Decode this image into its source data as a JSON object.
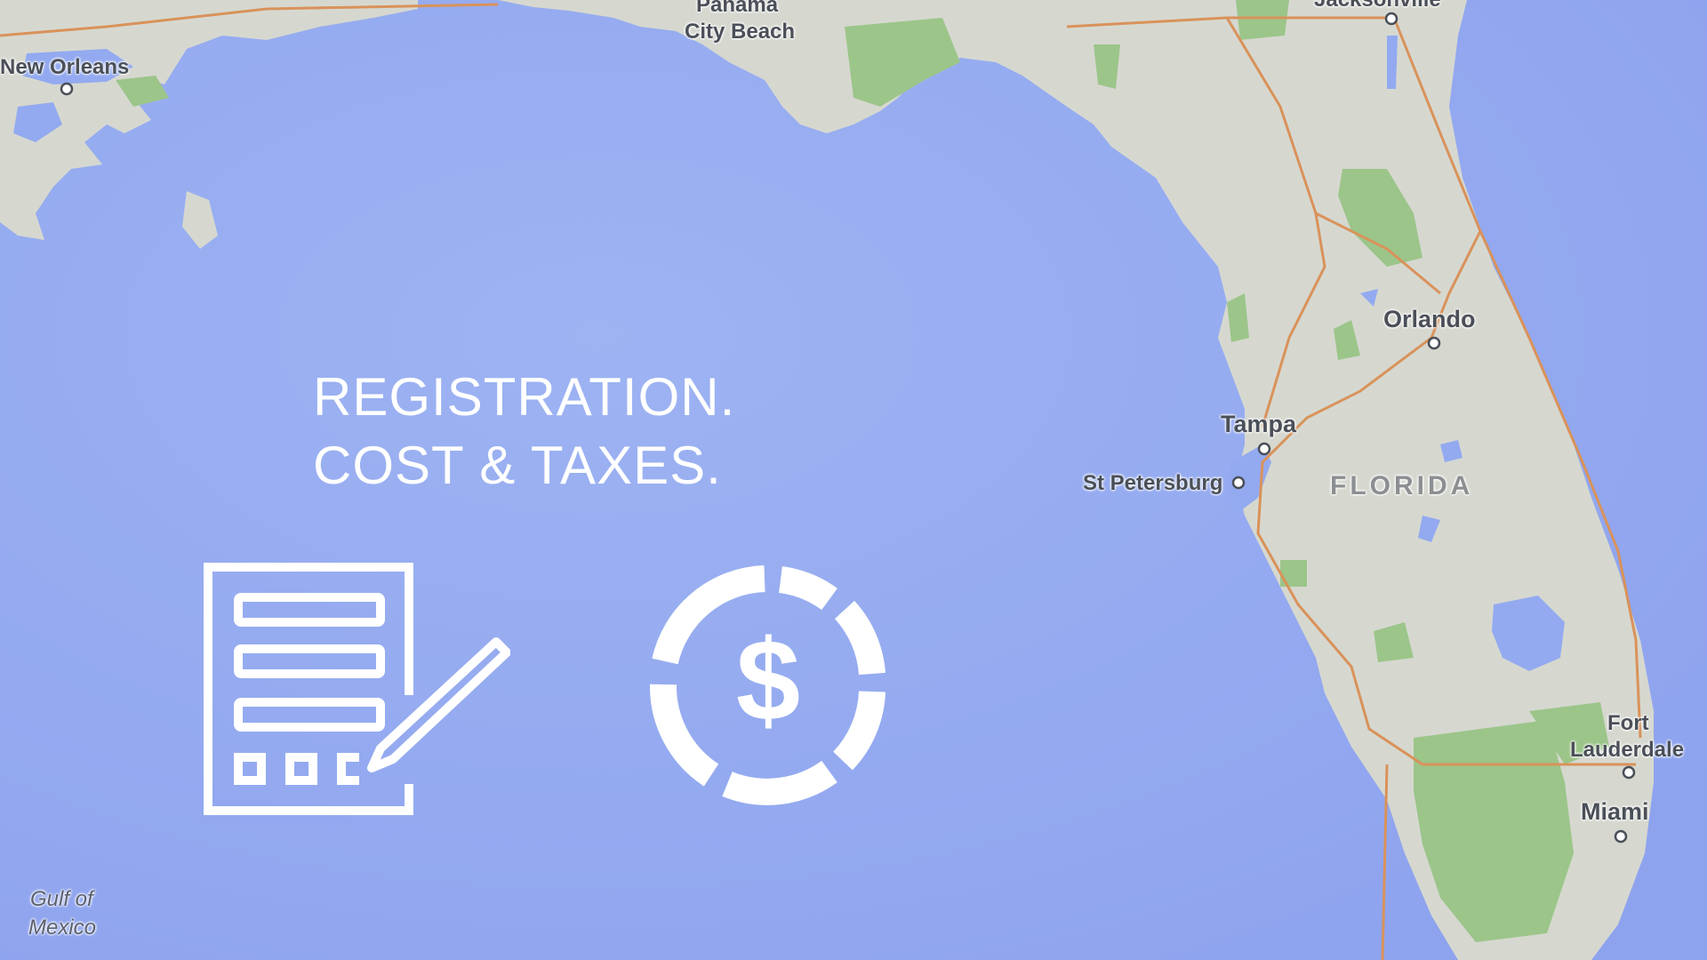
{
  "headline": {
    "line1": "REGISTRATION.",
    "line2": "COST & TAXES."
  },
  "icons": {
    "left": "registration-form-icon",
    "right": "dollar-coin-icon"
  },
  "map": {
    "places": {
      "new_orleans": "New Orleans",
      "panama_city_beach_1": "Panama",
      "panama_city_beach_2": "City Beach",
      "jacksonville": "Jacksonville",
      "orlando": "Orlando",
      "tampa": "Tampa",
      "st_petersburg": "St Petersburg",
      "florida": "FLORIDA",
      "fort_lauderdale_1": "Fort",
      "fort_lauderdale_2": "Lauderdale",
      "miami": "Miami",
      "gulf_1": "Gulf of",
      "gulf_2": "Mexico"
    }
  },
  "colors": {
    "water": "#93aaf0",
    "land": "#d6d8d0",
    "parks": "#9cc58a",
    "roads": "#d9925a",
    "overlay_text": "#ffffff"
  }
}
